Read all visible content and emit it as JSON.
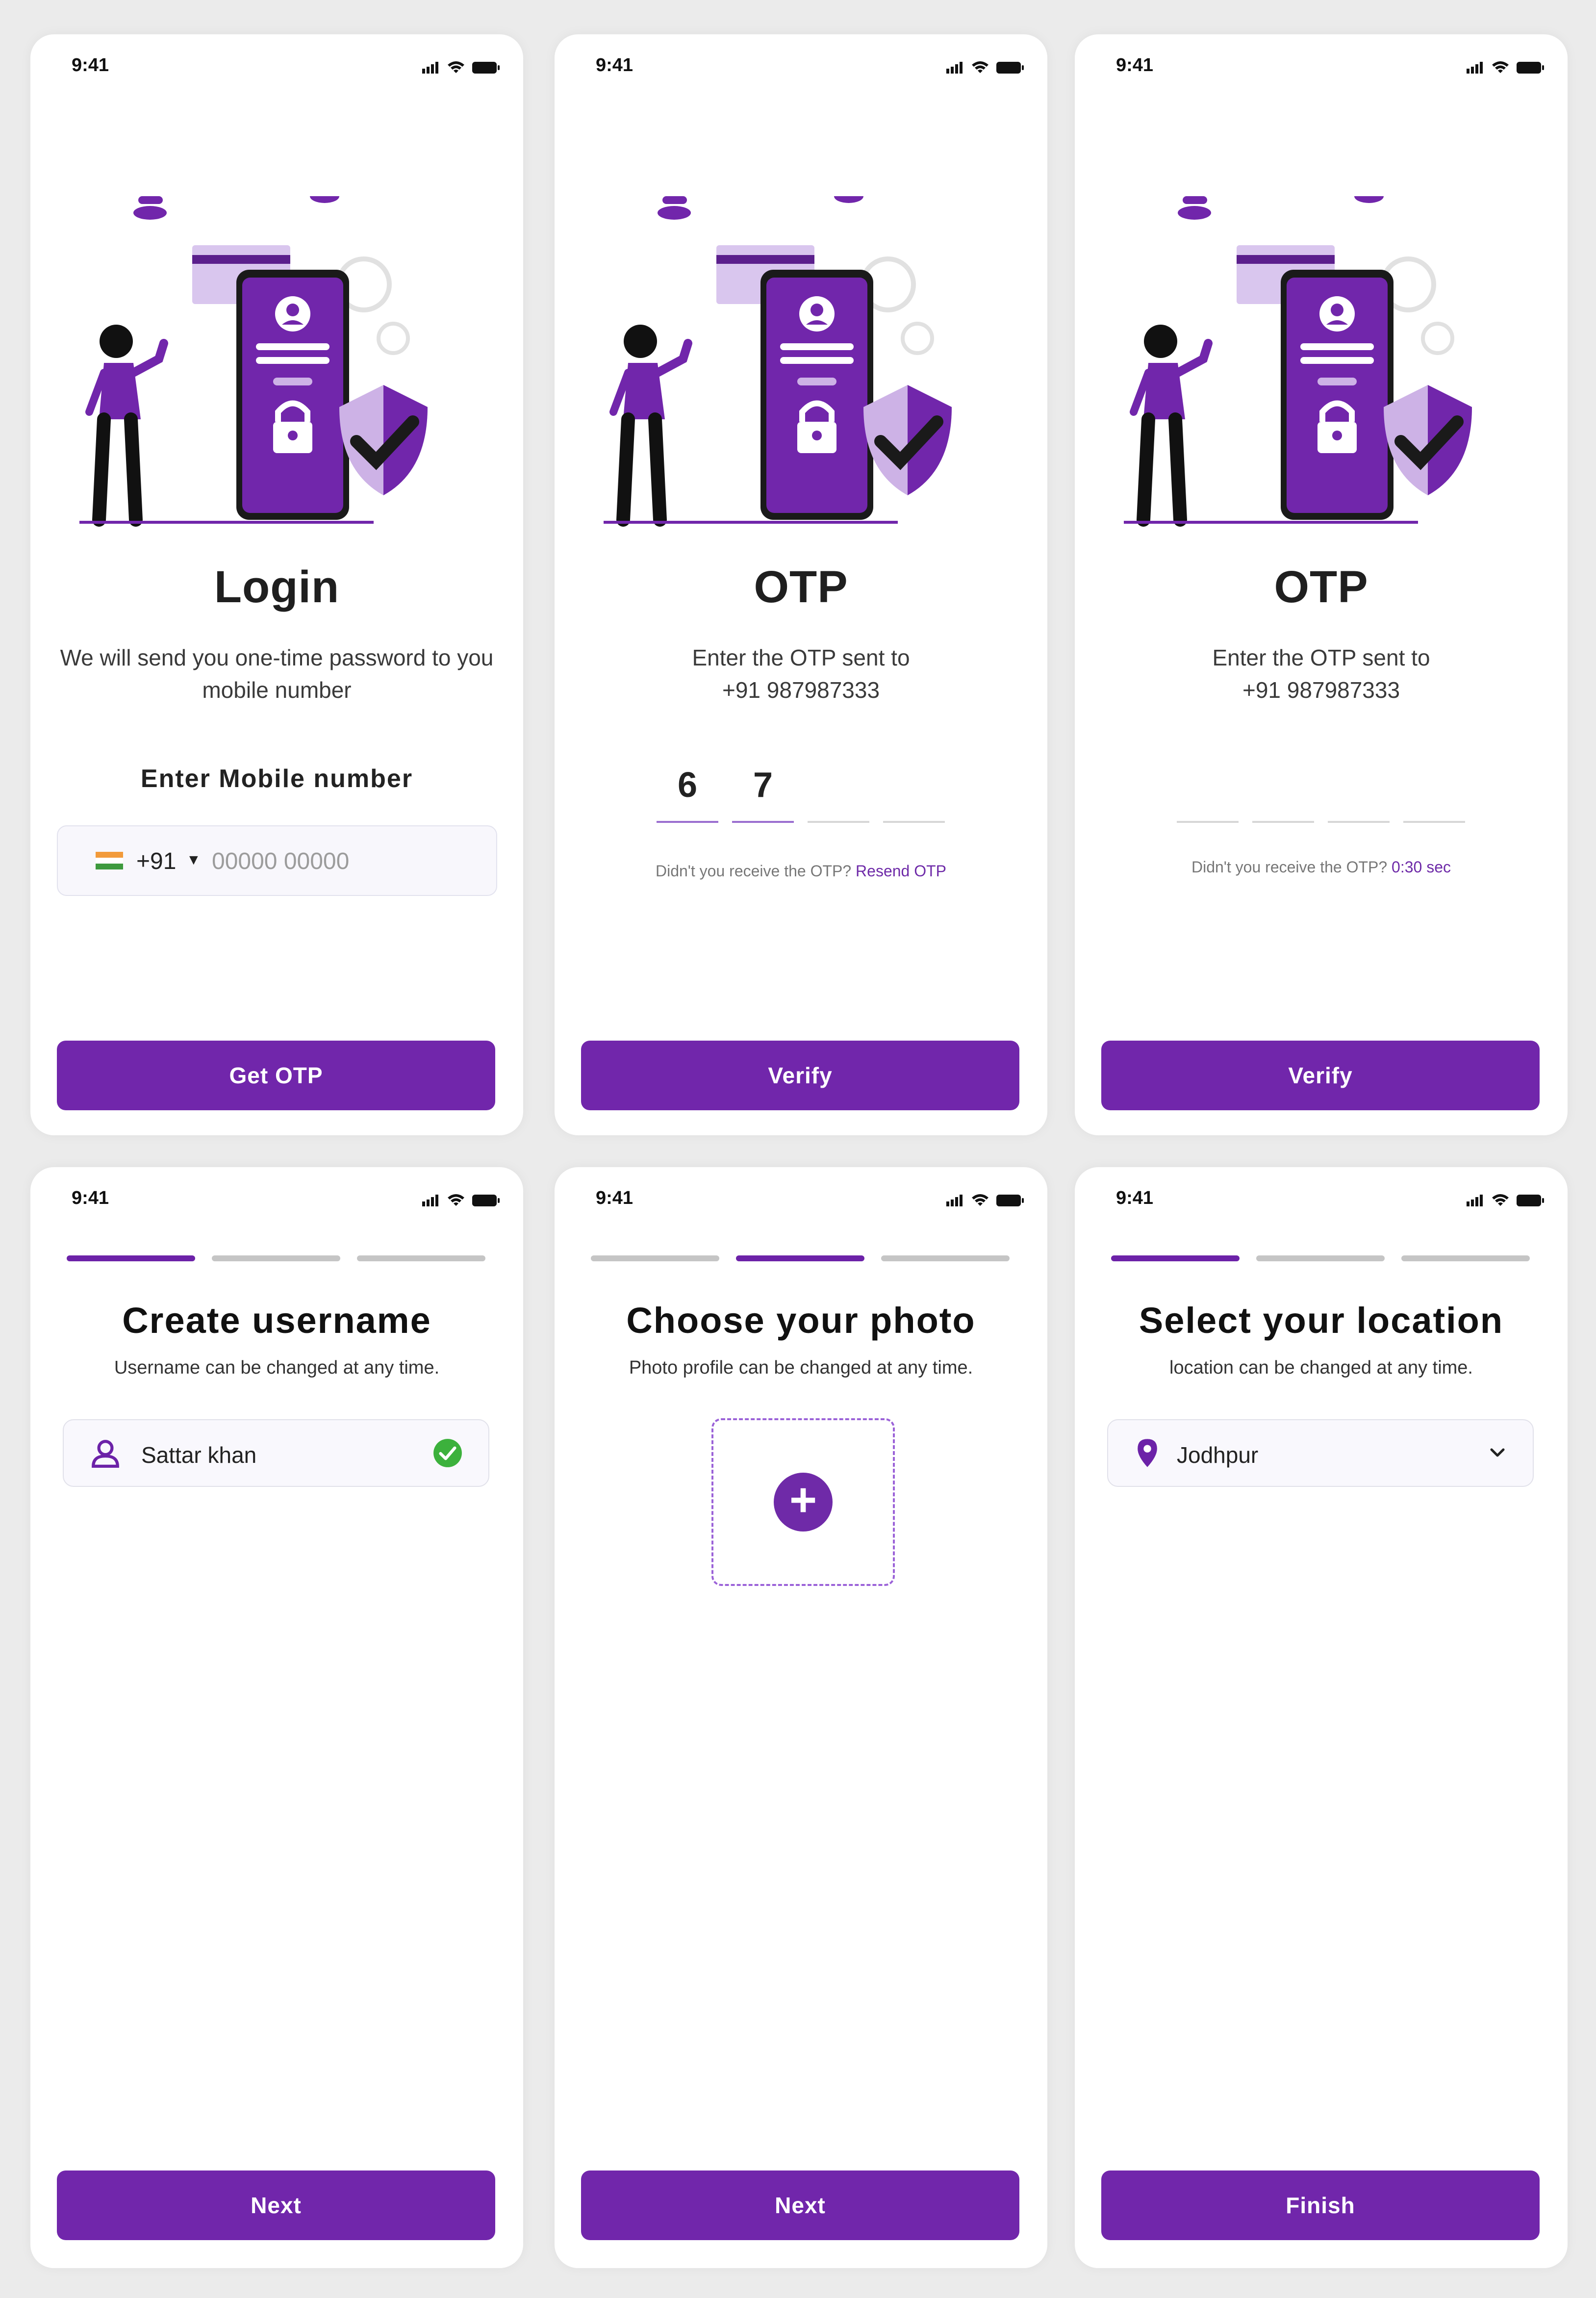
{
  "status_bar": {
    "time": "9:41"
  },
  "login": {
    "title": "Login",
    "subtitle": "We will send you one-time password to you mobile number",
    "field_label": "Enter Mobile number",
    "country_code": "+91",
    "phone_placeholder": "00000 00000",
    "button": "Get OTP"
  },
  "otp_filled": {
    "title": "OTP",
    "subtitle_line1": "Enter the OTP sent to",
    "subtitle_line2": "+91 987987333",
    "digits": [
      "6",
      "7",
      "",
      ""
    ],
    "resend_prefix": "Didn't you receive the OTP?",
    "resend_link": "Resend OTP",
    "button": "Verify"
  },
  "otp_empty": {
    "title": "OTP",
    "subtitle_line1": "Enter the OTP sent to",
    "subtitle_line2": "+91 987987333",
    "digits": [
      "",
      "",
      "",
      ""
    ],
    "resend_prefix": "Didn't you receive the OTP?",
    "timer": "0:30 sec",
    "button": "Verify"
  },
  "username": {
    "progress_active_step": 1,
    "title": "Create username",
    "subtitle": "Username can be changed at any time.",
    "value": "Sattar khan",
    "button": "Next"
  },
  "photo": {
    "progress_active_step": 2,
    "title": "Choose your photo",
    "subtitle": "Photo profile can be changed at any time.",
    "button": "Next"
  },
  "location": {
    "progress_active_step": 1,
    "title": "Select your location",
    "subtitle": "location can be changed at any time.",
    "value": "Jodhpur",
    "button": "Finish"
  },
  "colors": {
    "accent": "#7126ab",
    "accent_light": "#cdb2e6",
    "success": "#3cb13c"
  }
}
